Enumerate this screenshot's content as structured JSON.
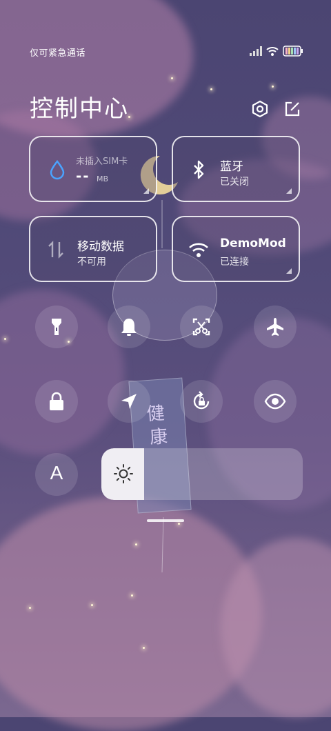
{
  "status_bar": {
    "carrier": "仅可紧急通话",
    "icons": [
      "signal-icon",
      "wifi-icon",
      "battery-icon"
    ]
  },
  "header": {
    "title": "控制中心",
    "settings_icon": "gear-hexagon-icon",
    "edit_icon": "edit-icon"
  },
  "tiles": {
    "data": {
      "label": "未插入SIM卡",
      "value": "--",
      "unit": "MB",
      "icon": "drop-icon"
    },
    "bluetooth": {
      "label": "蓝牙",
      "status": "已关闭",
      "icon": "bluetooth-icon"
    },
    "mobile_data": {
      "label": "移动数据",
      "status": "不可用",
      "icon": "mobile-data-icon"
    },
    "wifi": {
      "label": "DemoMod",
      "status": "已连接",
      "icon": "wifi-icon"
    }
  },
  "toggles_row1": [
    "flashlight-icon",
    "bell-icon",
    "screenshot-icon",
    "airplane-icon"
  ],
  "toggles_row2": [
    "lock-icon",
    "location-icon",
    "rotation-lock-icon",
    "eye-icon"
  ],
  "font_button": {
    "label": "A",
    "icon": "font-size-icon"
  },
  "brightness": {
    "icon": "sun-icon",
    "level": 0.2
  },
  "wallpaper_text": [
    "健",
    "康"
  ]
}
